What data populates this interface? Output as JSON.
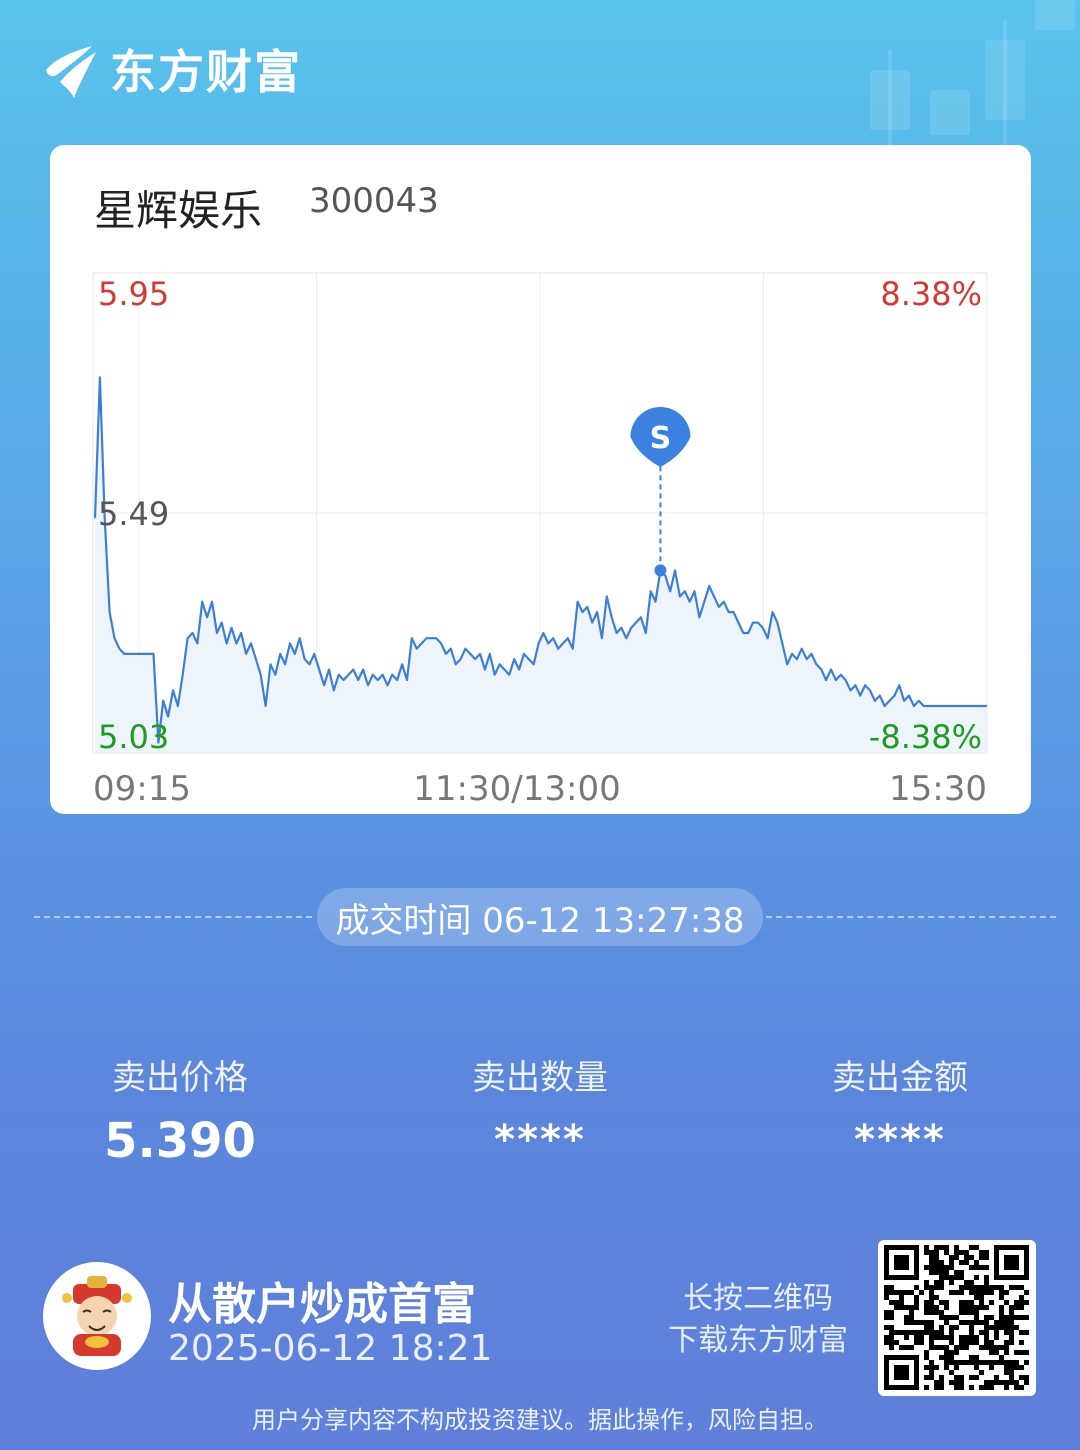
{
  "brand": {
    "name": "东方财富",
    "logo_icon": "eastmoney-logo-icon"
  },
  "stock": {
    "name": "星辉娱乐",
    "code": "300043"
  },
  "chart_data": {
    "type": "line",
    "y_labels": {
      "high": "5.95",
      "mid": "5.49",
      "low": "5.03"
    },
    "pct_labels": {
      "high": "8.38%",
      "low": "-8.38%"
    },
    "x_labels": [
      "09:15",
      "11:30/13:00",
      "15:30"
    ],
    "ylim": [
      5.03,
      5.95
    ],
    "marker": {
      "label": "S",
      "price": 5.39
    },
    "series": [
      {
        "values": [
          5.48,
          5.75,
          5.48,
          5.3,
          5.25,
          5.23,
          5.22,
          5.22,
          5.22,
          5.22,
          5.22,
          5.22,
          5.22,
          5.05,
          5.13,
          5.1,
          5.15,
          5.12,
          5.18,
          5.25,
          5.26,
          5.24,
          5.32,
          5.29,
          5.32,
          5.26,
          5.28,
          5.24,
          5.27,
          5.24,
          5.26,
          5.22,
          5.24,
          5.21,
          5.18,
          5.12,
          5.2,
          5.18,
          5.22,
          5.2,
          5.24,
          5.22,
          5.25,
          5.21,
          5.2,
          5.22,
          5.19,
          5.16,
          5.19,
          5.15,
          5.18,
          5.17,
          5.18,
          5.19,
          5.17,
          5.19,
          5.16,
          5.18,
          5.17,
          5.18,
          5.16,
          5.18,
          5.17,
          5.2,
          5.17,
          5.25,
          5.23,
          5.24,
          5.25,
          5.25,
          5.25,
          5.24,
          5.22,
          5.23,
          5.2,
          5.21,
          5.23,
          5.22,
          5.21,
          5.22,
          5.19,
          5.22,
          5.18,
          5.2,
          5.19,
          5.18,
          5.21,
          5.19,
          5.22,
          5.21,
          5.2,
          5.24,
          5.26,
          5.24,
          5.25,
          5.23,
          5.24,
          5.25,
          5.23,
          5.32,
          5.3,
          5.31,
          5.28,
          5.3,
          5.25,
          5.33,
          5.29,
          5.26,
          5.27,
          5.25,
          5.27,
          5.28,
          5.29,
          5.26,
          5.34,
          5.32,
          5.38,
          5.37,
          5.34,
          5.38,
          5.33,
          5.34,
          5.32,
          5.34,
          5.29,
          5.32,
          5.35,
          5.33,
          5.31,
          5.32,
          5.3,
          5.3,
          5.28,
          5.26,
          5.26,
          5.28,
          5.28,
          5.27,
          5.25,
          5.3,
          5.28,
          5.24,
          5.2,
          5.22,
          5.21,
          5.23,
          5.21,
          5.22,
          5.2,
          5.19,
          5.17,
          5.19,
          5.17,
          5.18,
          5.17,
          5.15,
          5.16,
          5.14,
          5.16,
          5.15,
          5.13,
          5.14,
          5.12,
          5.13,
          5.14,
          5.16,
          5.13,
          5.14,
          5.12,
          5.13,
          5.12,
          5.12,
          5.12,
          5.12,
          5.12,
          5.12,
          5.12,
          5.12,
          5.12,
          5.12,
          5.12,
          5.12,
          5.12,
          5.12
        ]
      }
    ]
  },
  "trade": {
    "time_label": "成交时间 06-12 13:27:38"
  },
  "stats": [
    {
      "label": "卖出价格",
      "value": "5.390"
    },
    {
      "label": "卖出数量",
      "value": "****"
    },
    {
      "label": "卖出金额",
      "value": "****"
    }
  ],
  "footer": {
    "slogan": "从散户炒成首富",
    "datetime": "2025-06-12 18:21",
    "qr_hint_1": "长按二维码",
    "qr_hint_2": "下载东方财富",
    "disclaimer": "用户分享内容不构成投资建议。据此操作，风险自担。",
    "avatar_icon": "caishen-avatar-icon",
    "qr_icon": "qr-code-icon"
  },
  "colors": {
    "line": "#3d7fd6",
    "up": "#d23b35",
    "down": "#1f9b1f",
    "marker": "#3b82e0"
  }
}
